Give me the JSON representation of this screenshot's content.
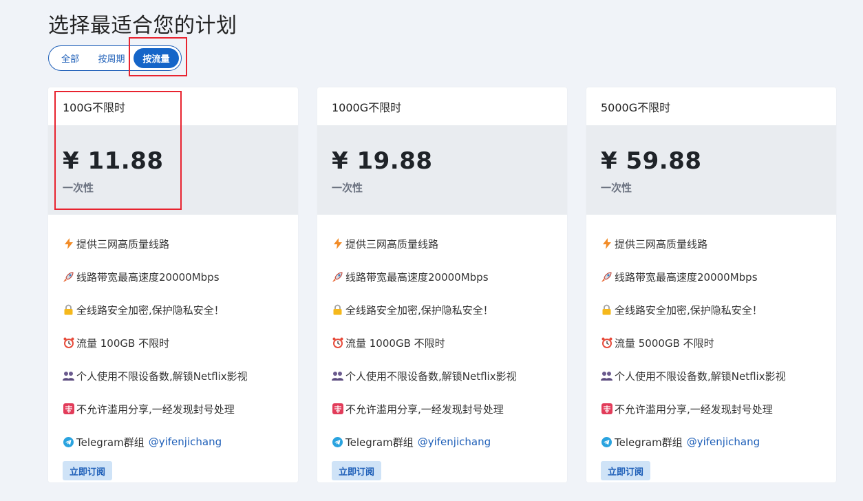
{
  "page": {
    "title": "选择最适合您的计划"
  },
  "filters": [
    {
      "label": "全部",
      "active": false
    },
    {
      "label": "按周期",
      "active": false
    },
    {
      "label": "按流量",
      "active": true
    }
  ],
  "colors": {
    "accent": "#1565c8",
    "highlight": "#e8232f",
    "price_bg": "#e9ecf0",
    "button_bg": "#cfe3f7"
  },
  "plans": [
    {
      "name": "100G不限时",
      "price": "¥ 11.88",
      "price_note": "一次性",
      "features": [
        {
          "icon": "lightning-icon",
          "text": "提供三网高质量线路"
        },
        {
          "icon": "rocket-icon",
          "text": "线路带宽最高速度20000Mbps"
        },
        {
          "icon": "lock-icon",
          "text": "全线路安全加密,保护隐私安全！"
        },
        {
          "icon": "alarm-clock-icon",
          "text": "流量 100GB 不限时"
        },
        {
          "icon": "people-icon",
          "text": "个人使用不限设备数,解锁Netflix影视"
        },
        {
          "icon": "forbidden-sign-icon",
          "text": "不允许滥用分享,一经发现封号处理"
        }
      ],
      "telegram_label": "Telegram群组",
      "telegram_link": "@yifenjichang",
      "subscribe_label": "立即订阅"
    },
    {
      "name": "1000G不限时",
      "price": "¥ 19.88",
      "price_note": "一次性",
      "features": [
        {
          "icon": "lightning-icon",
          "text": "提供三网高质量线路"
        },
        {
          "icon": "rocket-icon",
          "text": "线路带宽最高速度20000Mbps"
        },
        {
          "icon": "lock-icon",
          "text": "全线路安全加密,保护隐私安全！"
        },
        {
          "icon": "alarm-clock-icon",
          "text": "流量 1000GB 不限时"
        },
        {
          "icon": "people-icon",
          "text": "个人使用不限设备数,解锁Netflix影视"
        },
        {
          "icon": "forbidden-sign-icon",
          "text": "不允许滥用分享,一经发现封号处理"
        }
      ],
      "telegram_label": "Telegram群组",
      "telegram_link": "@yifenjichang",
      "subscribe_label": "立即订阅"
    },
    {
      "name": "5000G不限时",
      "price": "¥ 59.88",
      "price_note": "一次性",
      "features": [
        {
          "icon": "lightning-icon",
          "text": "提供三网高质量线路"
        },
        {
          "icon": "rocket-icon",
          "text": "线路带宽最高速度20000Mbps"
        },
        {
          "icon": "lock-icon",
          "text": "全线路安全加密,保护隐私安全！"
        },
        {
          "icon": "alarm-clock-icon",
          "text": "流量 5000GB 不限时"
        },
        {
          "icon": "people-icon",
          "text": "个人使用不限设备数,解锁Netflix影视"
        },
        {
          "icon": "forbidden-sign-icon",
          "text": "不允许滥用分享,一经发现封号处理"
        }
      ],
      "telegram_label": "Telegram群组",
      "telegram_link": "@yifenjichang",
      "subscribe_label": "立即订阅"
    }
  ]
}
